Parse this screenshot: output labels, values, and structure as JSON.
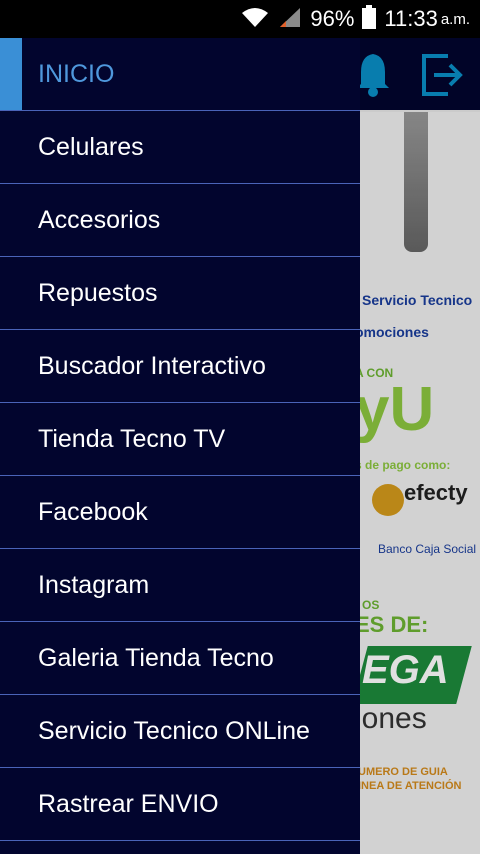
{
  "status_bar": {
    "battery_percent": "96%",
    "time": "11:33",
    "ampm": "a.m."
  },
  "background": {
    "servicio_tecnico": "Servicio Tecnico",
    "promociones": "omociones",
    "a_con": "A CON",
    "payu": "yU",
    "medios_pago": "s de pago como:",
    "efecty": "efecty",
    "banco": "Banco Caja Social",
    "os": "OS",
    "es_de": "ES DE:",
    "ega": "EGA",
    "iones": "iones",
    "numero_guia": "UMERO DE GUIA",
    "linea_atencion": "INEA DE ATENCIÓN"
  },
  "drawer": {
    "items": [
      {
        "label": "INICIO"
      },
      {
        "label": "Celulares"
      },
      {
        "label": "Accesorios"
      },
      {
        "label": "Repuestos"
      },
      {
        "label": "Buscador Interactivo"
      },
      {
        "label": "Tienda Tecno TV"
      },
      {
        "label": "Facebook"
      },
      {
        "label": "Instagram"
      },
      {
        "label": "Galeria Tienda Tecno"
      },
      {
        "label": "Servicio Tecnico ONLine"
      },
      {
        "label": "Rastrear ENVIO"
      }
    ]
  },
  "colors": {
    "drawer_bg": "#02052e",
    "active_text": "#4f98dc",
    "active_indicator": "#3a8fd6",
    "divider": "#4a63b8"
  }
}
